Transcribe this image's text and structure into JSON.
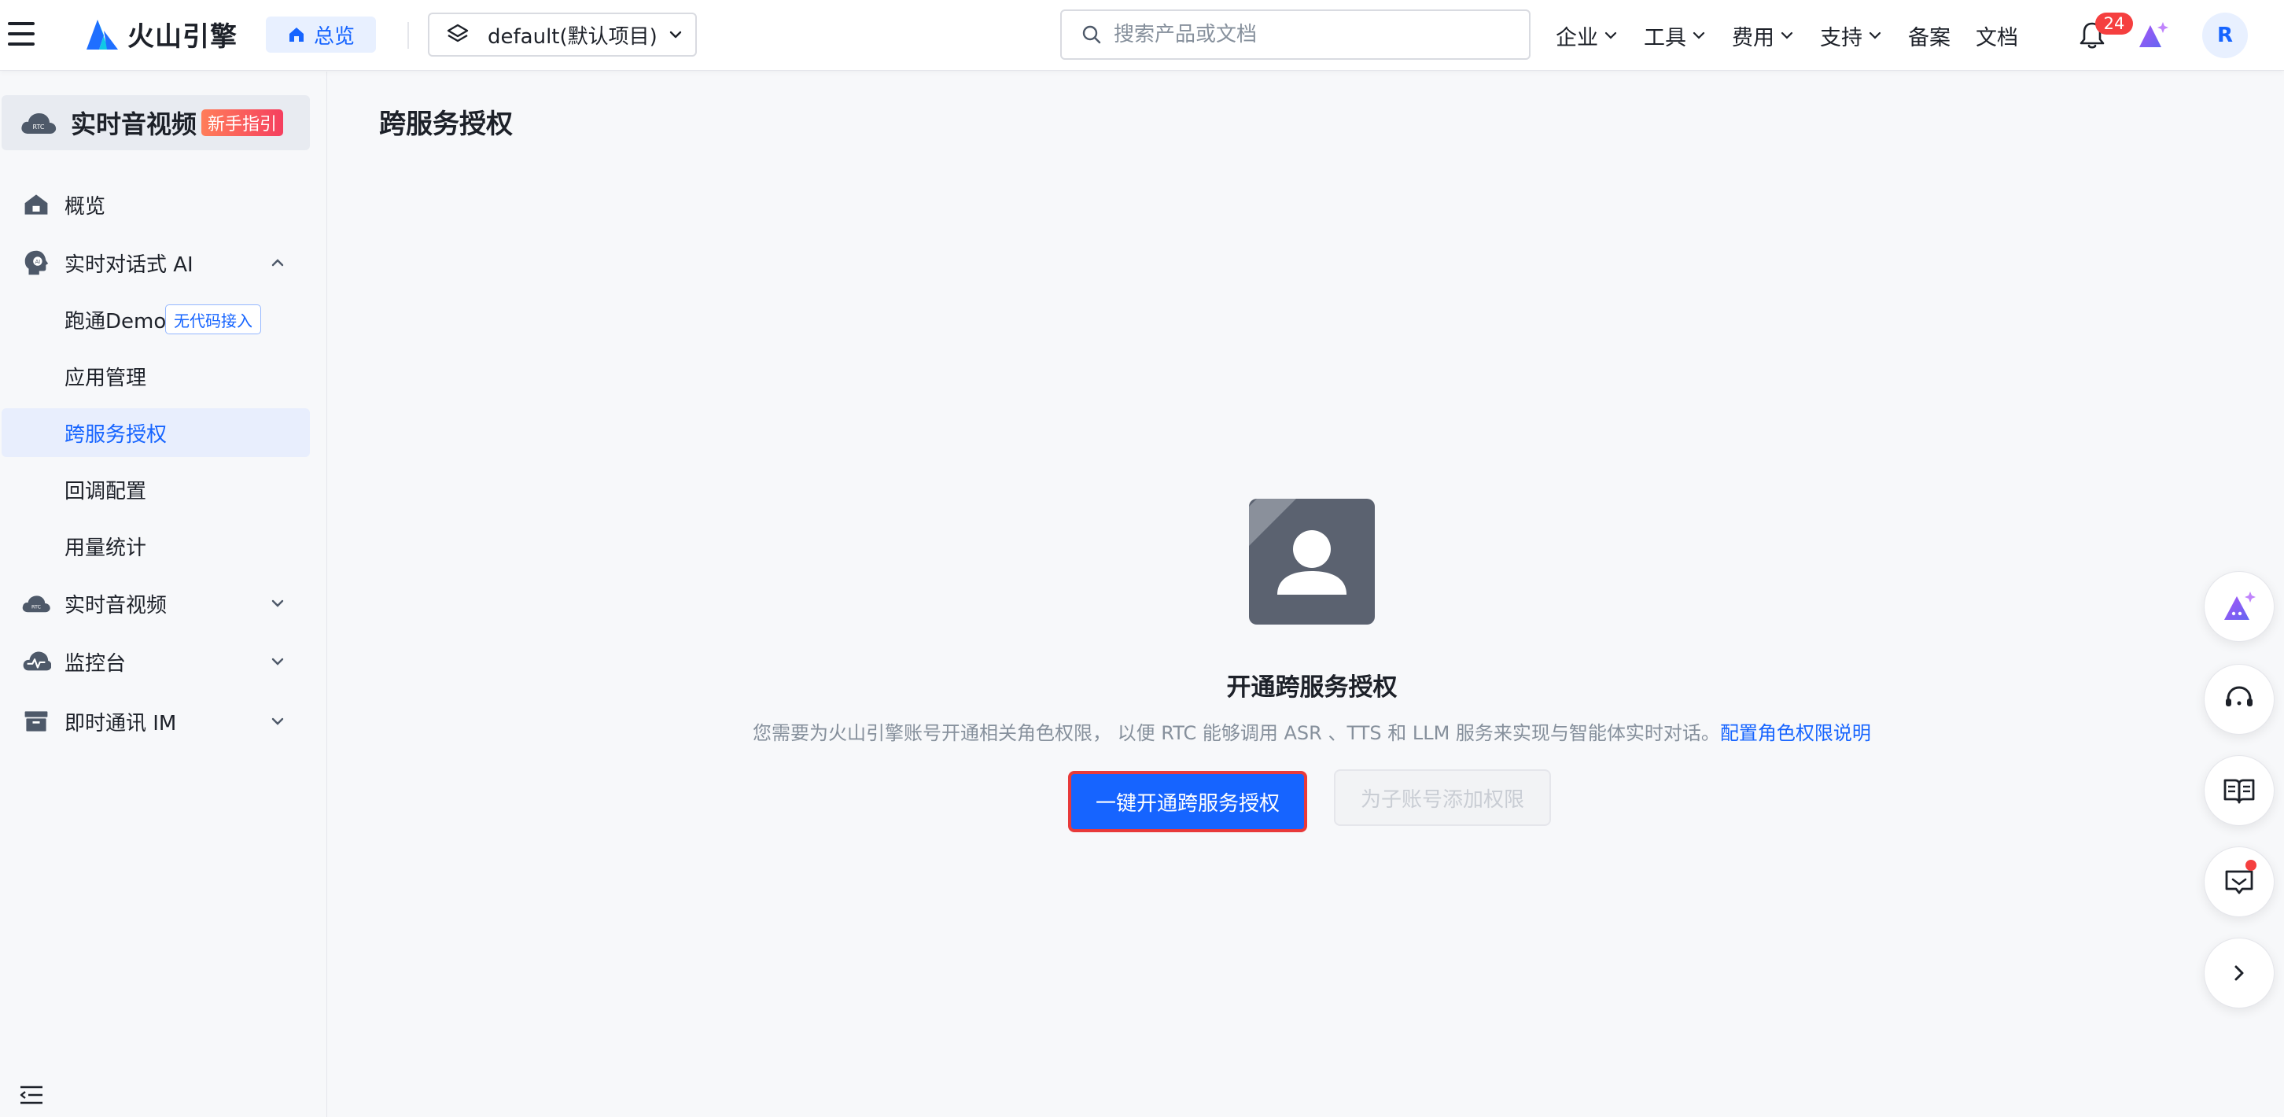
{
  "topbar": {
    "brand": "火山引擎",
    "home_label": "总览",
    "project": "default(默认项目)",
    "search_placeholder": "搜索产品或文档",
    "nav": [
      {
        "label": "企业"
      },
      {
        "label": "工具"
      },
      {
        "label": "费用"
      },
      {
        "label": "支持"
      },
      {
        "label": "备案"
      },
      {
        "label": "文档"
      }
    ],
    "notification_count": "24",
    "avatar_initial": "R"
  },
  "sidebar": {
    "product_title": "实时音视频",
    "guide_badge": "新手指引",
    "items": [
      {
        "label": "概览"
      },
      {
        "label": "实时对话式 AI"
      },
      {
        "label": "跑通Demo",
        "badge": "无代码接入"
      },
      {
        "label": "应用管理"
      },
      {
        "label": "跨服务授权"
      },
      {
        "label": "回调配置"
      },
      {
        "label": "用量统计"
      },
      {
        "label": "实时音视频"
      },
      {
        "label": "监控台"
      },
      {
        "label": "即时通讯 IM"
      }
    ]
  },
  "main": {
    "page_title": "跨服务授权",
    "empty_title": "开通跨服务授权",
    "empty_desc": "您需要为火山引擎账号开通相关角色权限， 以便 RTC 能够调用 ASR 、TTS 和 LLM 服务来实现与智能体实时对话。",
    "empty_link": "配置角色权限说明",
    "primary_button": "一键开通跨服务授权",
    "secondary_button": "为子账号添加权限"
  },
  "colors": {
    "accent": "#1664ff",
    "badge_red": "#f53f3f",
    "highlight_border": "#e83a3a"
  }
}
